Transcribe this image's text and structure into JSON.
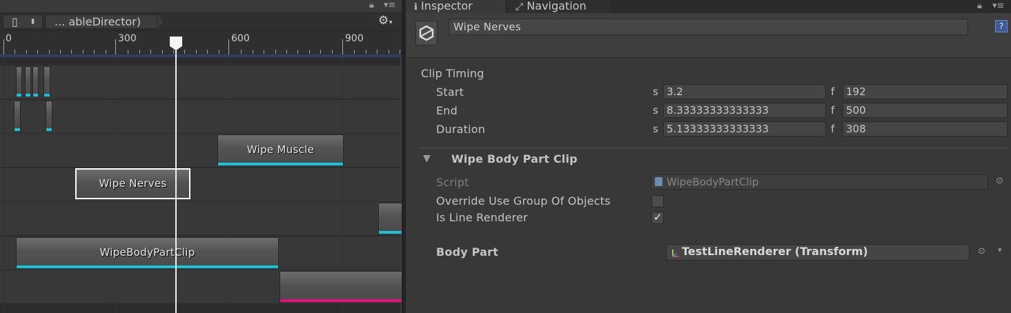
{
  "timeline": {
    "toolbar": {
      "view_toggle": "▯",
      "asset_name": "... ableDirector)"
    },
    "ruler": {
      "tick_labels": [
        "0",
        "300",
        "600",
        "900"
      ]
    },
    "clips": {
      "wipe_muscle": "Wipe Muscle",
      "wipe_nerves": "Wipe Nerves",
      "wipe_body_part_clip": "WipeBodyPartClip"
    }
  },
  "inspector": {
    "tabs": {
      "inspector": "Inspector",
      "navigation": "Navigation"
    },
    "object_name": "Wipe Nerves",
    "clip_timing": {
      "title": "Clip Timing",
      "rows": [
        {
          "label": "Start",
          "s_unit": "s",
          "seconds": "3.2",
          "f_unit": "f",
          "frames": "192"
        },
        {
          "label": "End",
          "s_unit": "s",
          "seconds": "8.33333333333333",
          "f_unit": "f",
          "frames": "500"
        },
        {
          "label": "Duration",
          "s_unit": "s",
          "seconds": "5.13333333333333",
          "f_unit": "f",
          "frames": "308"
        }
      ]
    },
    "component": {
      "title": "Wipe Body Part Clip",
      "script_label": "Script",
      "script_value": "WipeBodyPartClip",
      "override_label": "Override Use Group Of Objects",
      "override_checked": false,
      "line_renderer_label": "Is Line Renderer",
      "line_renderer_checked": true,
      "line_renderer_mark": "✓",
      "body_part_label": "Body Part",
      "body_part_value": "TestLineRenderer (Transform)"
    }
  }
}
